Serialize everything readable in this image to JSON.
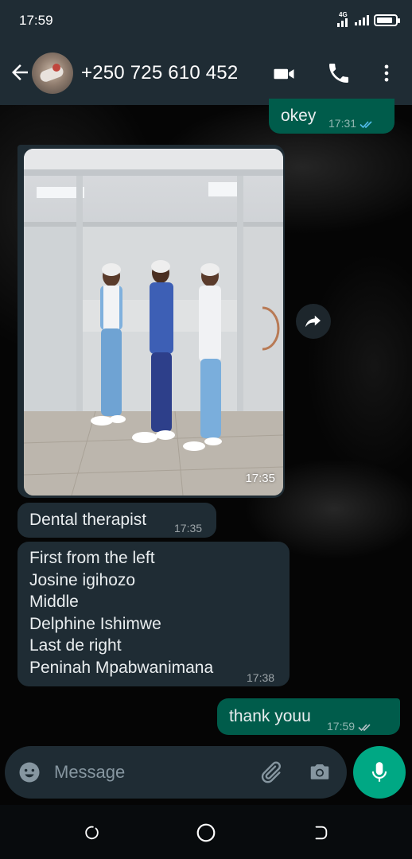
{
  "status_bar": {
    "time": "17:59",
    "network_label": "4G",
    "battery_level": 0.85
  },
  "header": {
    "contact_name": "+250 725 610 452",
    "icons": [
      "back-arrow-icon",
      "video-call-icon",
      "phone-call-icon",
      "more-options-icon"
    ]
  },
  "messages": [
    {
      "direction": "out",
      "text": "okey",
      "time": "17:31",
      "status": "read"
    },
    {
      "direction": "in",
      "type": "image",
      "time": "17:35"
    },
    {
      "direction": "in",
      "text": "Dental therapist",
      "time": "17:35"
    },
    {
      "direction": "in",
      "lines": [
        "First from the left",
        "Josine igihozo",
        "Middle",
        "Delphine Ishimwe",
        "Last de right",
        "Peninah Mpabwanimana"
      ],
      "time": "17:38"
    },
    {
      "direction": "out",
      "text": "thank youu",
      "time": "17:59",
      "status": "delivered"
    }
  ],
  "input": {
    "placeholder": "Message",
    "value": ""
  },
  "colors": {
    "header_bg": "#1f2c34",
    "outgoing_bubble": "#005c4b",
    "incoming_bubble": "#1f2c34",
    "read_ticks": "#53bdeb",
    "accent": "#00a884"
  }
}
